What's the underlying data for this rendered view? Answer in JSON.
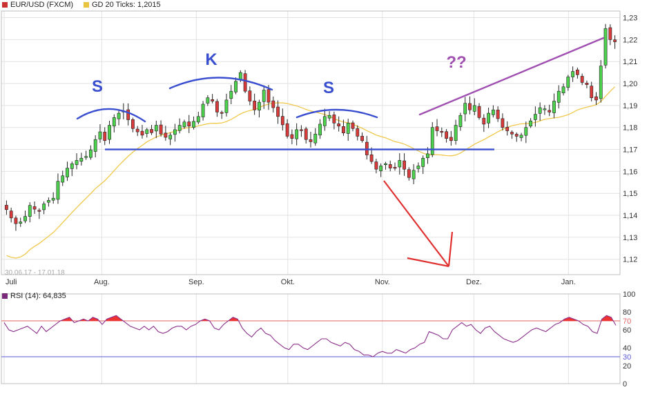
{
  "legend": {
    "main_series": "EUR/USD (FXCM)",
    "ma_series": "GD 20 Ticks: 1,2015",
    "date_range": "30.06.17 - 17.01.18",
    "rsi_series": "RSI (14): 64,835"
  },
  "colors": {
    "up": "#4cd24c",
    "down": "#d93a3a",
    "ma": "#f0c84a",
    "rsi": "#8a2e8a",
    "rsi_fill": "#ee3333",
    "upper_band": "#e06060",
    "lower_band": "#5a5ad8",
    "arc": "#3a4fd0",
    "trend": "#a050b0",
    "arrow": "#e03030",
    "grid": "#e2e2e2",
    "frame": "#bdbdbd",
    "main_swatch": "#c83232",
    "ma_swatch": "#e8c440",
    "rsi_swatch": "#7a2a7a"
  },
  "annotations": {
    "left_shoulder": "S",
    "head": "K",
    "right_shoulder": "S",
    "question": "??"
  },
  "chart_data": [
    {
      "type": "candlestick",
      "ylim": [
        1.113,
        1.233
      ],
      "y_ticks": [
        "1,12",
        "1,13",
        "1,14",
        "1,15",
        "1,16",
        "1,17",
        "1,18",
        "1,19",
        "1,20",
        "1,21",
        "1,22",
        "1,23"
      ],
      "x_ticks": [
        {
          "label": "Juli",
          "day": 0
        },
        {
          "label": "Aug.",
          "day": 32
        },
        {
          "label": "Sep.",
          "day": 63
        },
        {
          "label": "Okt.",
          "day": 93
        },
        {
          "label": "Nov.",
          "day": 124
        },
        {
          "label": "Dez.",
          "day": 154
        },
        {
          "label": "Jan.",
          "day": 185
        }
      ],
      "x_range_days": [
        0,
        201
      ],
      "candles_closes": [
        1.1426,
        1.1388,
        1.1362,
        1.137,
        1.1395,
        1.1445,
        1.1428,
        1.1418,
        1.1452,
        1.1468,
        1.1478,
        1.1555,
        1.158,
        1.1615,
        1.1635,
        1.165,
        1.166,
        1.1668,
        1.1698,
        1.1745,
        1.178,
        1.174,
        1.181,
        1.1845,
        1.1865,
        1.1875,
        1.1835,
        1.1795,
        1.178,
        1.1765,
        1.179,
        1.1776,
        1.181,
        1.177,
        1.1755,
        1.1765,
        1.179,
        1.181,
        1.1825,
        1.1806,
        1.1828,
        1.185,
        1.1906,
        1.1935,
        1.192,
        1.187,
        1.1868,
        1.1925,
        1.1965,
        1.201,
        1.205,
        1.1965,
        1.192,
        1.188,
        1.1915,
        1.197,
        1.1915,
        1.189,
        1.185,
        1.1812,
        1.176,
        1.175,
        1.179,
        1.179,
        1.1745,
        1.1735,
        1.177,
        1.1815,
        1.185,
        1.1855,
        1.182,
        1.1806,
        1.1775,
        1.182,
        1.1795,
        1.176,
        1.174,
        1.1675,
        1.1645,
        1.161,
        1.1625,
        1.1635,
        1.1615,
        1.1618,
        1.165,
        1.161,
        1.1572,
        1.1605,
        1.1625,
        1.166,
        1.168,
        1.18,
        1.1785,
        1.178,
        1.175,
        1.174,
        1.181,
        1.1855,
        1.191,
        1.188,
        1.19,
        1.1845,
        1.1815,
        1.1865,
        1.188,
        1.184,
        1.18,
        1.1785,
        1.177,
        1.176,
        1.1765,
        1.18,
        1.183,
        1.186,
        1.189,
        1.1885,
        1.187,
        1.192,
        1.1965,
        1.1985,
        1.203,
        1.2055,
        1.204,
        1.2005,
        1.1995,
        1.1935,
        1.1925,
        1.208,
        1.225,
        1.22,
        1.219
      ],
      "ma_series_name": "GD 20 Ticks"
    },
    {
      "type": "line",
      "series_name": "RSI (14)",
      "last_value": 64.835,
      "ylim": [
        0,
        100
      ],
      "y_ticks": [
        "100",
        "80",
        "70",
        "60",
        "40",
        "30",
        "20",
        "0"
      ],
      "bands": [
        70,
        30
      ],
      "values": [
        68,
        60,
        58,
        60,
        62,
        64,
        60,
        56,
        64,
        58,
        62,
        66,
        70,
        72,
        74,
        68,
        70,
        72,
        70,
        74,
        72,
        66,
        72,
        74,
        76,
        72,
        68,
        64,
        62,
        60,
        64,
        60,
        64,
        58,
        56,
        58,
        62,
        64,
        64,
        60,
        64,
        66,
        70,
        72,
        70,
        62,
        60,
        66,
        70,
        74,
        72,
        62,
        56,
        52,
        58,
        62,
        56,
        54,
        48,
        44,
        40,
        38,
        44,
        44,
        40,
        38,
        42,
        46,
        50,
        50,
        46,
        44,
        42,
        46,
        44,
        38,
        36,
        32,
        32,
        30,
        34,
        36,
        34,
        34,
        38,
        36,
        34,
        38,
        40,
        44,
        46,
        58,
        56,
        54,
        50,
        50,
        60,
        64,
        68,
        64,
        66,
        60,
        56,
        62,
        64,
        58,
        54,
        50,
        48,
        46,
        48,
        52,
        56,
        60,
        62,
        60,
        58,
        62,
        66,
        68,
        72,
        74,
        72,
        70,
        66,
        64,
        58,
        56,
        72,
        76,
        74,
        65
      ]
    }
  ]
}
